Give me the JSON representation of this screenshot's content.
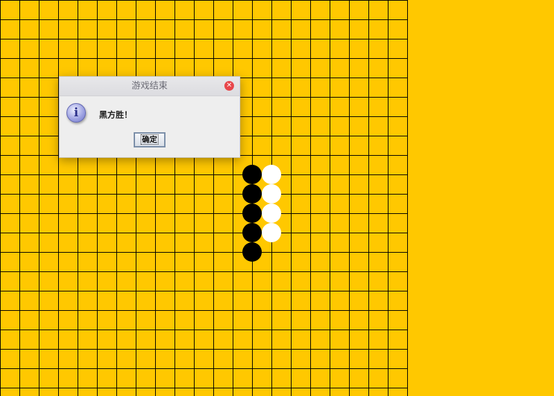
{
  "board": {
    "columns": 21,
    "rows": 21,
    "background": "#ffc800",
    "line_color": "#000000",
    "stones": [
      {
        "color": "black",
        "col": 13,
        "row": 9
      },
      {
        "color": "black",
        "col": 13,
        "row": 10
      },
      {
        "color": "black",
        "col": 13,
        "row": 11
      },
      {
        "color": "black",
        "col": 13,
        "row": 12
      },
      {
        "color": "black",
        "col": 13,
        "row": 13
      },
      {
        "color": "white",
        "col": 14,
        "row": 9
      },
      {
        "color": "white",
        "col": 14,
        "row": 10
      },
      {
        "color": "white",
        "col": 14,
        "row": 11
      },
      {
        "color": "white",
        "col": 14,
        "row": 12
      }
    ]
  },
  "dialog": {
    "title": "游戏结束",
    "message": "黑方胜！",
    "ok_label": "确定",
    "icon": "info-icon",
    "close_icon": "close-icon"
  }
}
